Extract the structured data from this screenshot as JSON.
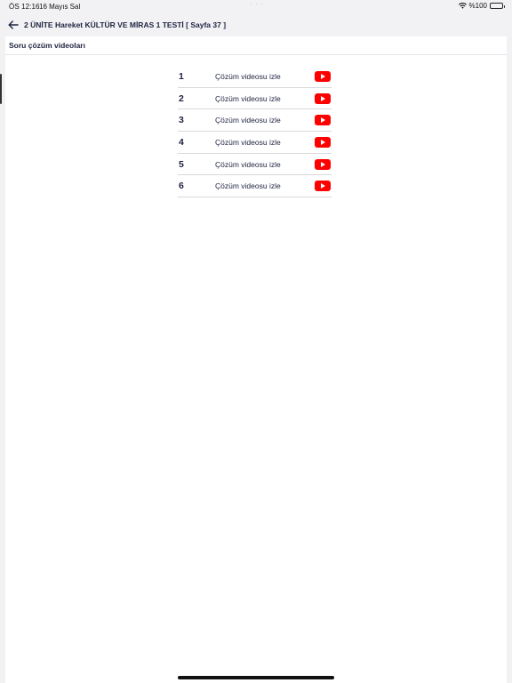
{
  "status_bar": {
    "time": "ÖS 12:16",
    "date": "16 Mayıs Sal",
    "dots": "· · ·",
    "battery_text": "%100"
  },
  "nav": {
    "title": "2 ÜNİTE Hareket KÜLTÜR VE MİRAS 1 TESTİ [ Sayfa 37 ]",
    "back_icon": "arrow-left-icon"
  },
  "section": {
    "title": "Soru çözüm videoları"
  },
  "videos": [
    {
      "number": "1",
      "label": "Çözüm videosu izle"
    },
    {
      "number": "2",
      "label": "Çözüm videosu izle"
    },
    {
      "number": "3",
      "label": "Çözüm videosu izle"
    },
    {
      "number": "4",
      "label": "Çözüm videosu izle"
    },
    {
      "number": "5",
      "label": "Çözüm videosu izle"
    },
    {
      "number": "6",
      "label": "Çözüm videosu izle"
    }
  ],
  "colors": {
    "accent_text": "#1f2340",
    "youtube_red": "#ff0000",
    "background": "#f2f2f4"
  }
}
